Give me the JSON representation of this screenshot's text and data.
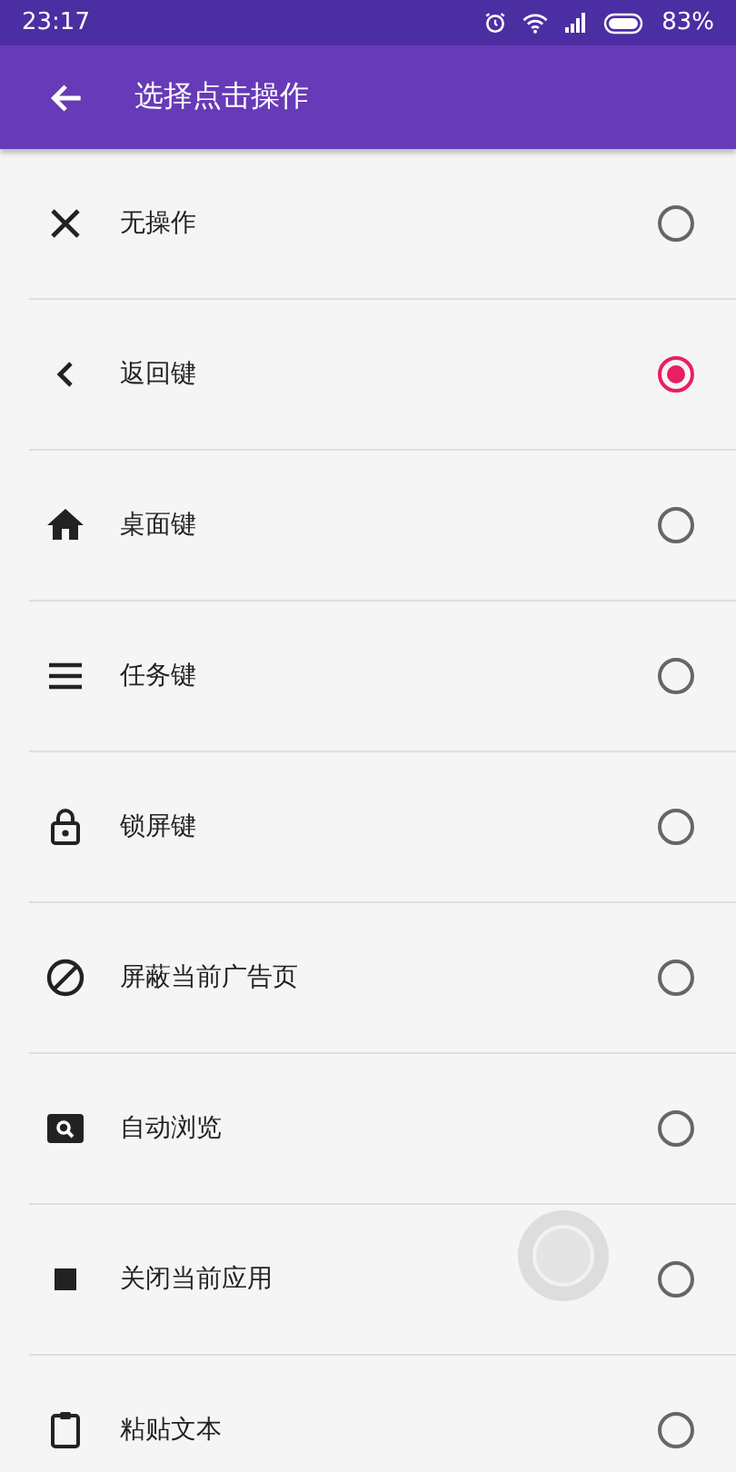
{
  "status_bar": {
    "time": "23:17",
    "battery": "83%"
  },
  "app_bar": {
    "title": "选择点击操作"
  },
  "options": [
    {
      "label": "无操作",
      "selected": false
    },
    {
      "label": "返回键",
      "selected": true
    },
    {
      "label": "桌面键",
      "selected": false
    },
    {
      "label": "任务键",
      "selected": false
    },
    {
      "label": "锁屏键",
      "selected": false
    },
    {
      "label": "屏蔽当前广告页",
      "selected": false
    },
    {
      "label": "自动浏览",
      "selected": false
    },
    {
      "label": "关闭当前应用",
      "selected": false
    },
    {
      "label": "粘贴文本",
      "selected": false
    }
  ]
}
